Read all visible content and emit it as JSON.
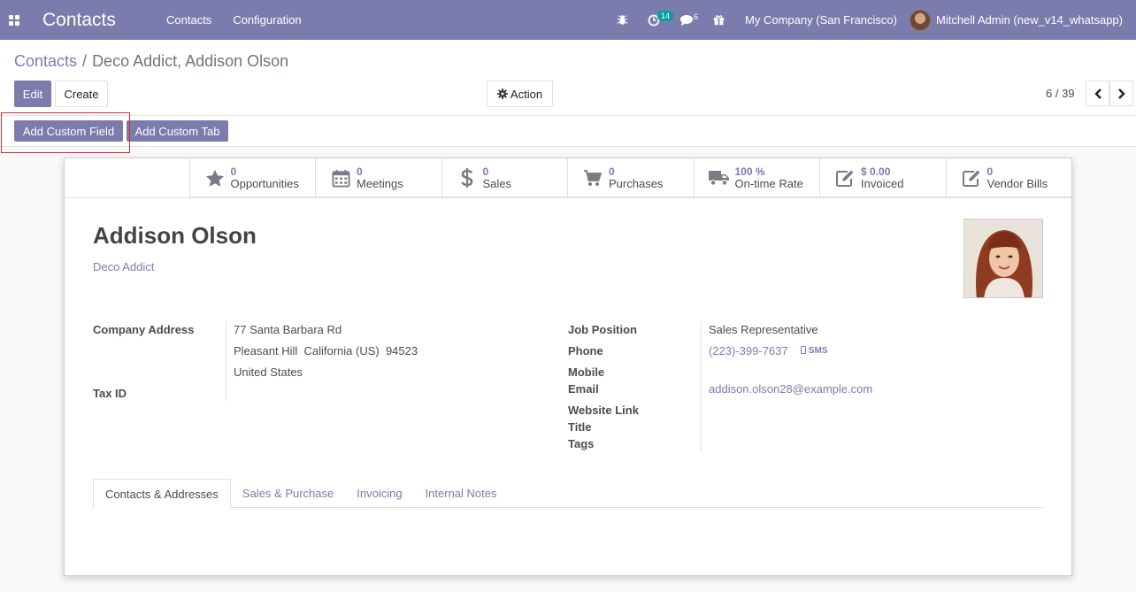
{
  "navbar": {
    "app_title": "Contacts",
    "menu": [
      "Contacts",
      "Configuration"
    ],
    "activity_count": "14",
    "message_count": "6",
    "company": "My Company (San Francisco)",
    "user": "Mitchell Admin (new_v14_whatsapp)",
    "bg_color": "#7c7bad"
  },
  "breadcrumb": {
    "parent": "Contacts",
    "separator": "/",
    "current": "Deco Addict, Addison Olson"
  },
  "toolbar": {
    "edit_label": "Edit",
    "create_label": "Create",
    "action_label": "Action",
    "pager": "6 / 39"
  },
  "custom_bar": {
    "add_field_label": "Add Custom Field",
    "add_tab_label": "Add Custom Tab"
  },
  "smart_buttons": [
    {
      "icon": "star-icon",
      "value": "0",
      "label": "Opportunities"
    },
    {
      "icon": "calendar-icon",
      "value": "0",
      "label": "Meetings"
    },
    {
      "icon": "dollar-icon",
      "value": "0",
      "label": "Sales"
    },
    {
      "icon": "cart-icon",
      "value": "0",
      "label": "Purchases"
    },
    {
      "icon": "truck-icon",
      "value": "100 %",
      "label": "On-time Rate"
    },
    {
      "icon": "pencil-square-icon",
      "value": "$ 0.00",
      "label": "Invoiced"
    },
    {
      "icon": "pencil-square-icon",
      "value": "0",
      "label": "Vendor Bills"
    }
  ],
  "contact": {
    "name": "Addison Olson",
    "company": "Deco Addict",
    "labels": {
      "company_address": "Company Address",
      "tax_id": "Tax ID",
      "job_position": "Job Position",
      "phone": "Phone",
      "mobile": "Mobile",
      "email": "Email",
      "website": "Website Link",
      "title": "Title",
      "tags": "Tags"
    },
    "address_street": "77 Santa Barbara Rd",
    "address_city_line": "Pleasant Hill  California (US)  94523",
    "address_country": "United States",
    "job_position": "Sales Representative",
    "phone": "(223)-399-7637",
    "sms_label": "SMS",
    "email": "addison.olson28@example.com"
  },
  "tabs": [
    "Contacts & Addresses",
    "Sales & Purchase",
    "Invoicing",
    "Internal Notes"
  ]
}
